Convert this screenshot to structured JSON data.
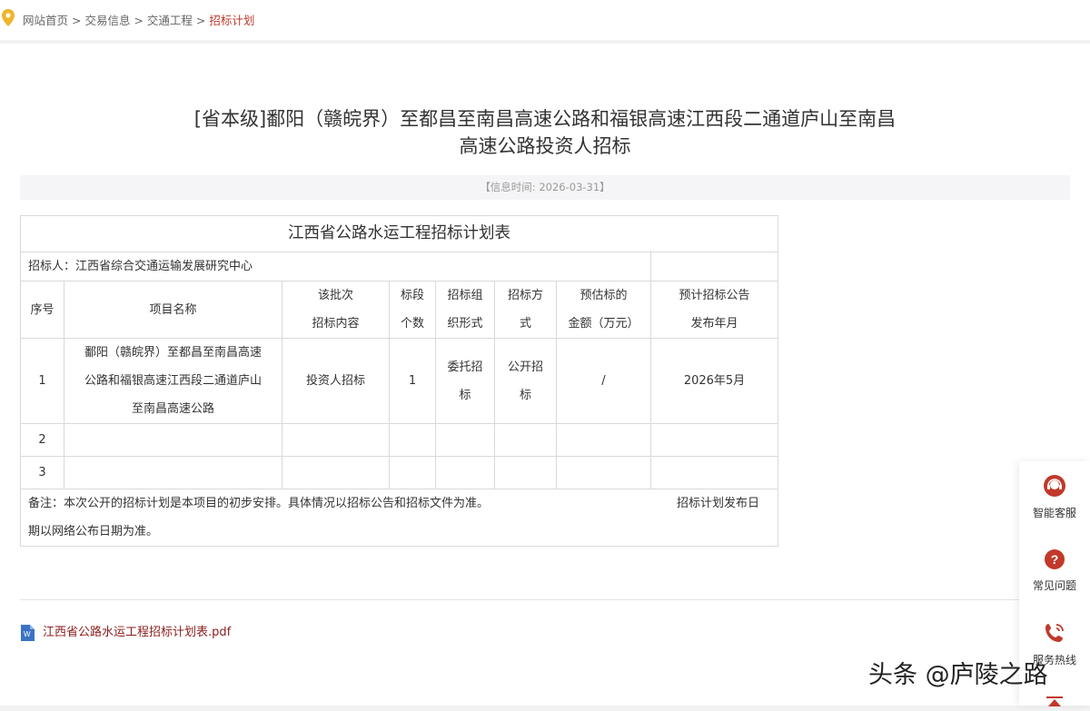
{
  "breadcrumb": {
    "items": [
      "网站首页",
      "交易信息",
      "交通工程"
    ],
    "current": "招标计划"
  },
  "notice": {
    "title_line1": "[省本级]鄱阳（赣皖界）至都昌至南昌高速公路和福银高速江西段二通道庐山至南昌",
    "title_line2": "高速公路投资人招标",
    "info_time": "【信息时间:  2026-03-31】"
  },
  "plan_table": {
    "title": "江西省公路水运工程招标计划表",
    "tenderer": "招标人：江西省综合交通运输发展研究中心",
    "headers": {
      "no": "序号",
      "name": "项目名称",
      "content_1": "该批次",
      "content_2": "招标内容",
      "sections_1": "标段",
      "sections_2": "个数",
      "org_1": "招标组",
      "org_2": "织形式",
      "method_1": "招标方",
      "method_2": "式",
      "amount_1": "预估标的",
      "amount_2": "金额（万元）",
      "date_1": "预计招标公告",
      "date_2": "发布年月"
    },
    "rows": [
      {
        "no": "1",
        "name_1": "鄱阳（赣皖界）至都昌至南昌高速",
        "name_2": "公路和福银高速江西段二通道庐山",
        "name_3": "至南昌高速公路",
        "content": "投资人招标",
        "sections": "1",
        "org_1": "委托招",
        "org_2": "标",
        "method_1": "公开招",
        "method_2": "标",
        "amount": "/",
        "date": "2026年5月"
      },
      {
        "no": "2"
      },
      {
        "no": "3"
      }
    ],
    "remark_line1": "备注：本次公开的招标计划是本项目的初步安排。具体情况以招标公告和招标文件为准。",
    "remark_line1_right": "招标计划发布日",
    "remark_line2": "期以网络公布日期为准。"
  },
  "attachment": {
    "filename": "江西省公路水运工程招标计划表.pdf",
    "icon": "word-doc-icon"
  },
  "side_panel": {
    "items": [
      {
        "label": "智能客服",
        "icon": "customer-service-icon"
      },
      {
        "label": "常见问题",
        "icon": "question-icon"
      },
      {
        "label": "服务热线",
        "icon": "phone-icon"
      }
    ],
    "accent_color": "#c0392b"
  },
  "watermark": "头条 @庐陵之路"
}
